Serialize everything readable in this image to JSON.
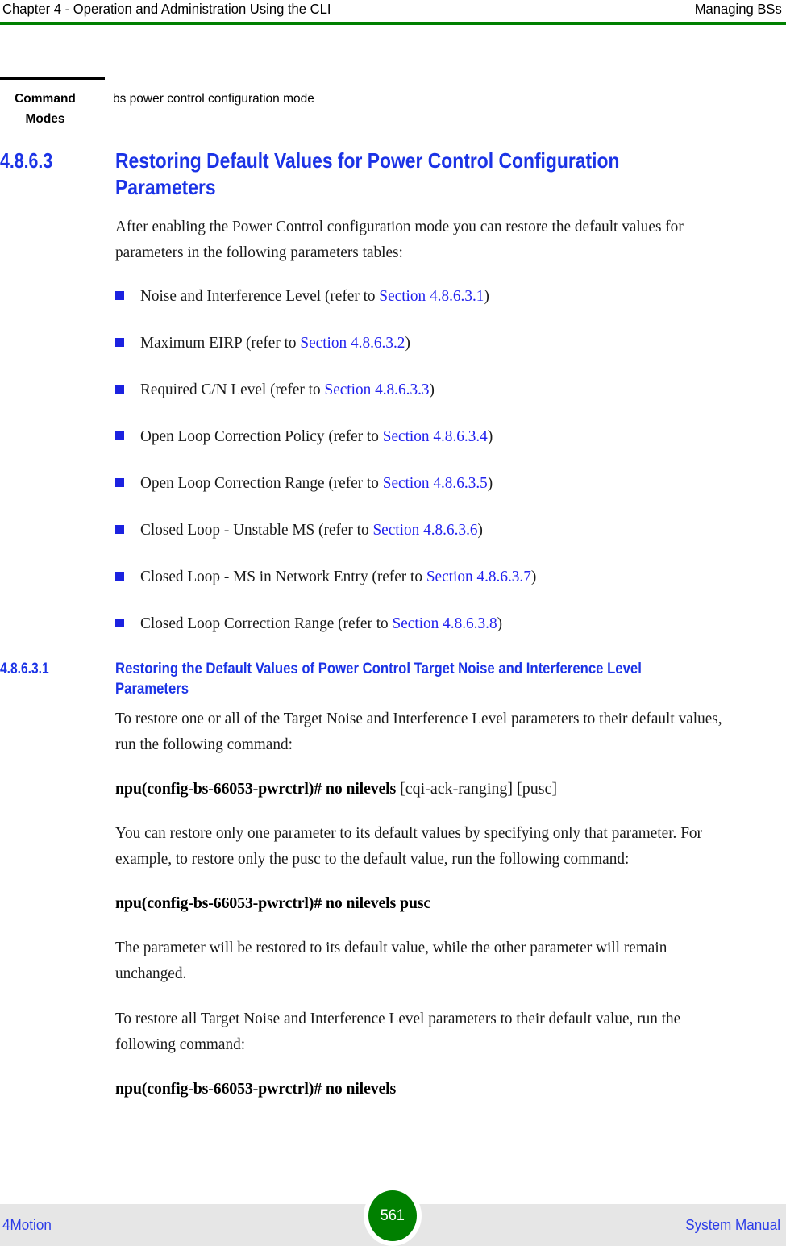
{
  "header": {
    "left": "Chapter 4 - Operation and Administration Using the CLI",
    "right": "Managing BSs",
    "rule_color": "#008000"
  },
  "command_modes": {
    "label": "Command Modes",
    "value": "bs power control configuration mode"
  },
  "section": {
    "number": "4.8.6.3",
    "title": "Restoring Default Values for Power Control Configuration Parameters",
    "intro": "After enabling the Power Control configuration mode you can restore the default values for parameters in the following parameters tables:",
    "bullets": [
      {
        "text": "Noise and Interference Level (refer to ",
        "xref": "Section 4.8.6.3.1",
        "tail": ")"
      },
      {
        "text": "Maximum EIRP (refer to ",
        "xref": "Section 4.8.6.3.2",
        "tail": ")"
      },
      {
        "text": "Required C/N Level (refer to ",
        "xref": "Section 4.8.6.3.3",
        "tail": ")"
      },
      {
        "text": "Open Loop Correction Policy (refer to ",
        "xref": "Section 4.8.6.3.4",
        "tail": ")"
      },
      {
        "text": "Open Loop Correction Range (refer to ",
        "xref": "Section 4.8.6.3.5",
        "tail": ")"
      },
      {
        "text": "Closed Loop - Unstable MS (refer to ",
        "xref": "Section 4.8.6.3.6",
        "tail": ")"
      },
      {
        "text": "Closed Loop - MS in Network Entry (refer to ",
        "xref": "Section 4.8.6.3.7",
        "tail": ")"
      },
      {
        "text": "Closed Loop Correction Range (refer to ",
        "xref": "Section 4.8.6.3.8",
        "tail": ")"
      }
    ]
  },
  "subsection": {
    "number": "4.8.6.3.1",
    "title": "Restoring the Default Values of Power Control Target Noise and Interference Level Parameters",
    "para1": "To restore one or all of the Target Noise and Interference Level parameters to their default values, run the following command:",
    "cli1_cmd": "npu(config-bs-66053-pwrctrl)# no nilevels",
    "cli1_args": " [cqi-ack-ranging] [pusc]",
    "para2": "You can restore only one parameter to its default values by specifying only that parameter. For example, to restore only the pusc to the default value, run the following command:",
    "cli2_cmd": "npu(config-bs-66053-pwrctrl)# no nilevels pusc",
    "para3": "The parameter will be restored to its default value, while the other parameter will remain unchanged.",
    "para4": "To restore all Target Noise and Interference Level parameters to their default value, run the following command:",
    "cli3_cmd": "npu(config-bs-66053-pwrctrl)# no nilevels"
  },
  "footer": {
    "left": "4Motion",
    "page_number": "561",
    "right": "System Manual",
    "badge_color": "#008000"
  },
  "colors": {
    "heading_blue": "#1b33e6",
    "link_blue": "#2222ee",
    "bullet_blue": "#1b22e0",
    "rule_green": "#008000",
    "footer_band": "#e6e6e6"
  }
}
